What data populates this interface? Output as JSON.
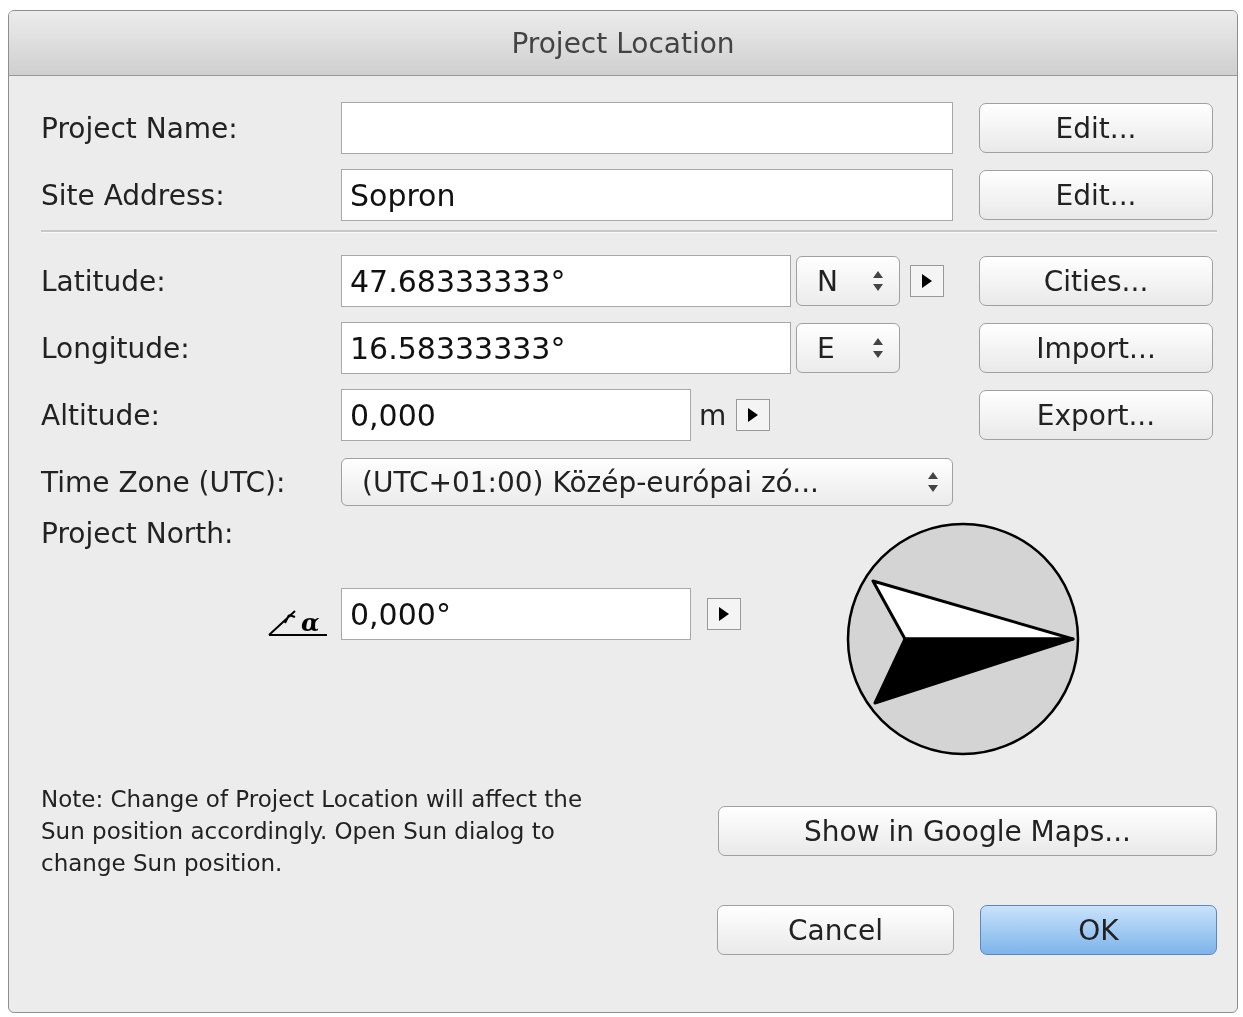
{
  "window": {
    "title": "Project Location"
  },
  "name_rows": [
    {
      "label": "Project Name:",
      "button": "Edit..."
    },
    {
      "label": "Site Address:",
      "value": "Sopron",
      "button": "Edit..."
    }
  ],
  "location_rows": [
    {
      "kind": "coordinate",
      "label": "Latitude:",
      "value": "47.68333333°",
      "hemisphere": "N",
      "menu_arrow": true,
      "button": "Cities..."
    },
    {
      "kind": "coordinate",
      "label": "Longitude:",
      "value": "16.58333333°",
      "hemisphere": "E",
      "menu_arrow": false,
      "button": "Import..."
    },
    {
      "kind": "unit",
      "label": "Altitude:",
      "value": "0,000",
      "unit": "m",
      "menu_arrow": true,
      "button": "Export..."
    },
    {
      "kind": "select",
      "label": "Time Zone (UTC):",
      "value": "(UTC+01:00) Közép-európai zó..."
    }
  ],
  "project_north": {
    "label": "Project North:",
    "angle_symbol": "α",
    "value": "0,000°",
    "menu_arrow": true
  },
  "note": "Note: Change of Project Location will affect the Sun position accordingly. Open Sun dialog to change Sun position.",
  "maps_button": "Show in Google Maps...",
  "footer_buttons": [
    {
      "label": "Cancel",
      "default": false
    },
    {
      "label": "OK",
      "default": true
    }
  ]
}
